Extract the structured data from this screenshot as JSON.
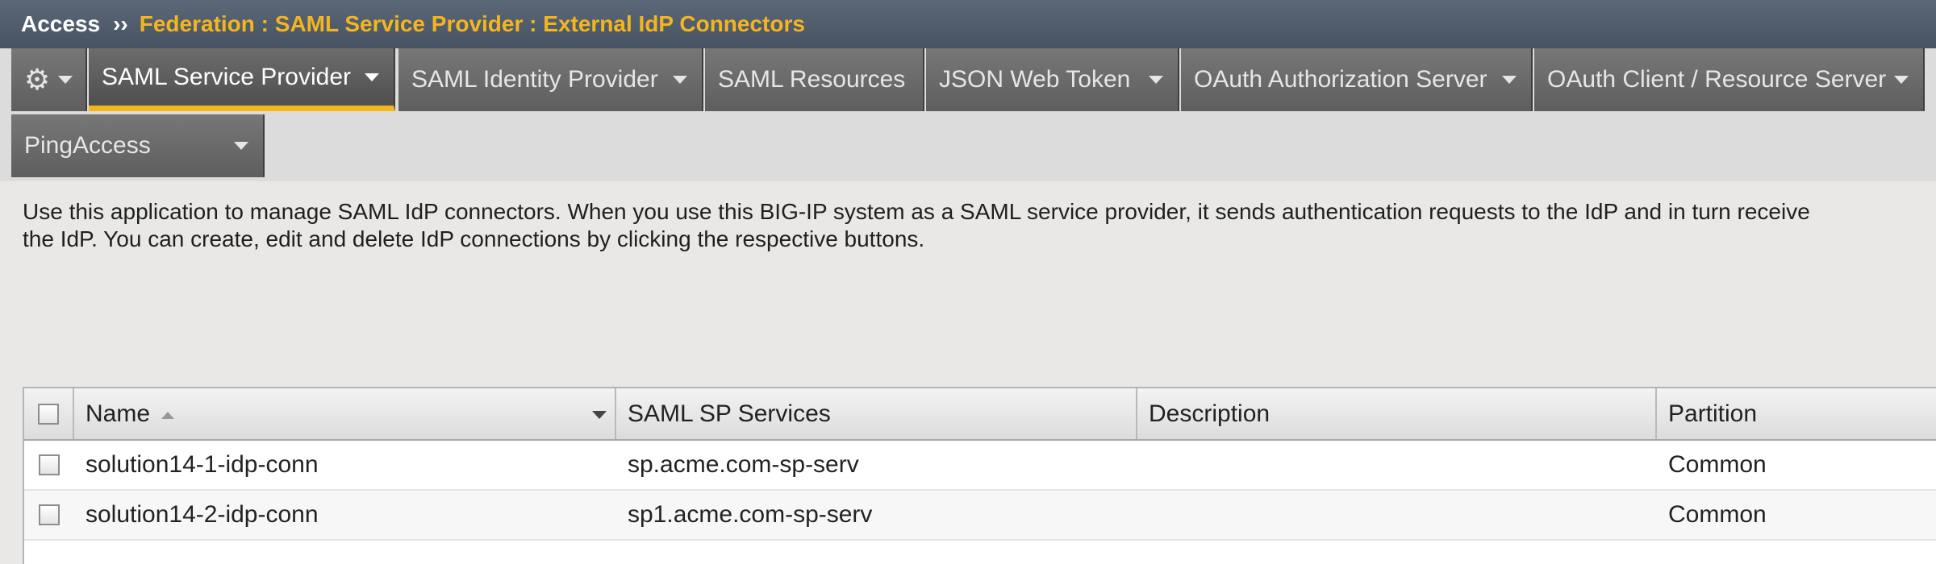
{
  "breadcrumb": {
    "root": "Access",
    "separator": "››",
    "path": "Federation : SAML Service Provider : External IdP Connectors"
  },
  "tabs": {
    "gear_icon": "gear-icon",
    "items": [
      {
        "label": "SAML Service Provider",
        "active": true,
        "has_menu": true
      },
      {
        "label": "SAML Identity Provider",
        "active": false,
        "has_menu": true
      },
      {
        "label": "SAML Resources",
        "active": false,
        "has_menu": false
      },
      {
        "label": "JSON Web Token",
        "active": false,
        "has_menu": true
      },
      {
        "label": "OAuth Authorization Server",
        "active": false,
        "has_menu": true
      },
      {
        "label": "OAuth Client / Resource Server",
        "active": false,
        "has_menu": true
      },
      {
        "label": "PingAccess",
        "active": false,
        "has_menu": true
      }
    ]
  },
  "description": {
    "line1": "Use this application to manage SAML IdP connectors. When you use this BIG-IP system as a SAML service provider, it sends authentication requests to the IdP and in turn receive",
    "line2": "the IdP. You can create, edit and delete IdP connections by clicking the respective buttons."
  },
  "table": {
    "columns": {
      "name": "Name",
      "services": "SAML SP Services",
      "description": "Description",
      "partition": "Partition"
    },
    "rows": [
      {
        "name": "solution14-1-idp-conn",
        "services": "sp.acme.com-sp-serv",
        "description": "",
        "partition": "Common"
      },
      {
        "name": "solution14-2-idp-conn",
        "services": "sp1.acme.com-sp-serv",
        "description": "",
        "partition": "Common"
      }
    ]
  },
  "colors": {
    "accent": "#f5b51e",
    "header_bg": "#4f5b6a",
    "tab_bg": "#666666"
  }
}
